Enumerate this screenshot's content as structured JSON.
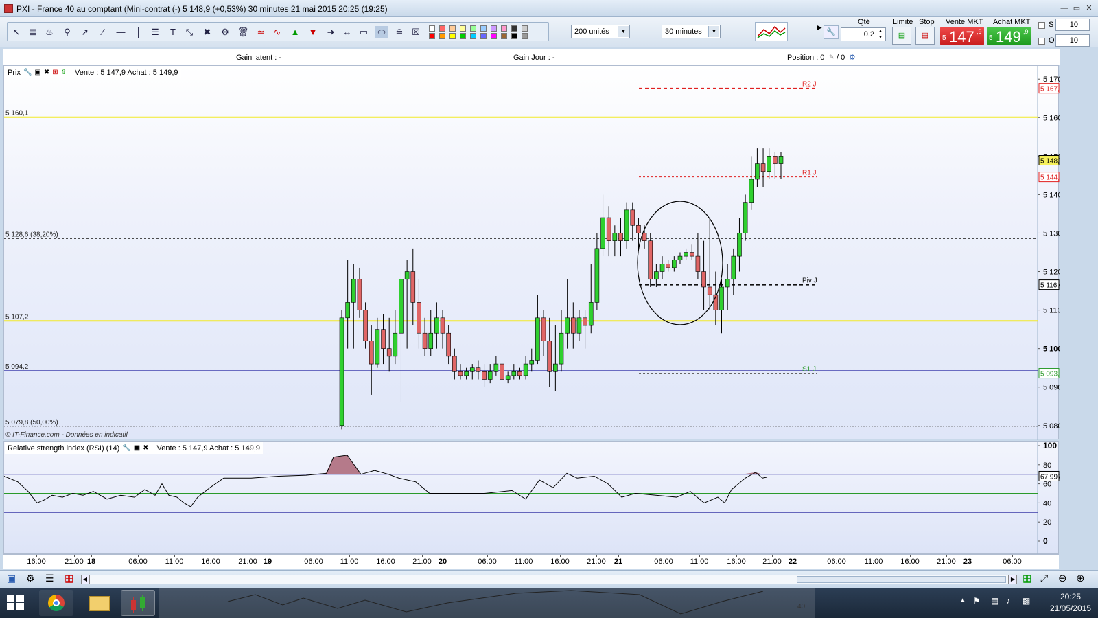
{
  "window": {
    "title": "PXI - France 40 au comptant (Mini-contrat  (-)    5 148,9 (+0,53%)    30 minutes  21 mai 2015 20:25 (19:25)"
  },
  "toolbar": {
    "units_select": "200 unités",
    "interval_select": "30 minutes",
    "qty_label": "Qté",
    "qty_value": "0.2",
    "limit_label": "Limite",
    "stop_label": "Stop",
    "sell_label": "Vente MKT",
    "sell_prefix": "5",
    "sell_main": "147",
    "sell_suffix": ",9",
    "buy_label": "Achat MKT",
    "buy_prefix": "5",
    "buy_main": "149",
    "buy_suffix": ",9",
    "s_label": "S",
    "s_value": "10",
    "o_label": "O",
    "o_value": "10",
    "colors": [
      "#ffffff",
      "#ff6666",
      "#ffcc99",
      "#ffff99",
      "#99ff99",
      "#99ccff",
      "#cc99ff",
      "#ff99cc",
      "#333333",
      "#cccccc",
      "#ff0000",
      "#ff9900",
      "#ffff00",
      "#00cc00",
      "#00ccff",
      "#6666ff",
      "#ff00ff",
      "#996633",
      "#000000",
      "#999999"
    ]
  },
  "infobar": {
    "gain_latent": "Gain latent : -",
    "gain_jour": "Gain Jour : -",
    "position": "Position : 0",
    "position_sep": "/  0"
  },
  "price_panel": {
    "label": "Prix",
    "quote": "Vente : 5 147,9 Achat : 5 149,9",
    "footer": "© IT-Finance.com - Données en indicatif",
    "left_labels": [
      "5 160,1",
      "5 128,6 (38,20%)",
      "5 107,2",
      "5 094,2",
      "5 079,8 (50,00%)"
    ],
    "pivot_labels": [
      "R2 J",
      "R1 J",
      "Piv J",
      "S1 J"
    ],
    "right_badges": [
      "5 167,6",
      "5 148,9",
      "5 144,6",
      "5 116,6",
      "5 093,6"
    ],
    "axis_ticks": [
      "5 170",
      "5 160",
      "5 150",
      "5 140",
      "5 130",
      "5 120",
      "5 110",
      "5 100",
      "5 090",
      "5 080"
    ]
  },
  "rsi_panel": {
    "label": "Relative strength index (RSI) (14)",
    "quote": "Vente : 5 147,9 Achat : 5 149,9",
    "value_badge": "67,997",
    "axis_ticks": [
      "100",
      "80",
      "60",
      "40",
      "20",
      "0"
    ]
  },
  "time_axis": {
    "labels": [
      "16:00",
      "21:00",
      "18",
      "06:00",
      "11:00",
      "16:00",
      "21:00",
      "19",
      "06:00",
      "11:00",
      "16:00",
      "21:00",
      "20",
      "06:00",
      "11:00",
      "16:00",
      "21:00",
      "21",
      "06:00",
      "11:00",
      "16:00",
      "21:00",
      "22",
      "06:00",
      "11:00",
      "16:00",
      "21:00",
      "23",
      "06:00"
    ]
  },
  "taskbar": {
    "time": "20:25",
    "date": "21/05/2015",
    "mini_label": "40"
  },
  "chart_data": {
    "type": "candlestick",
    "ylim": [
      5078,
      5172
    ],
    "levels": {
      "fib_5160_1": 5160.1,
      "fib_38_2": 5128.6,
      "level_5107_2": 5107.2,
      "level_5094_2": 5094.2,
      "fib_50": 5079.8,
      "R2": 5167.6,
      "R1": 5144.6,
      "Piv": 5116.6,
      "S1": 5093.6
    },
    "candles": [
      [
        5080,
        5108,
        5079,
        5110
      ],
      [
        5108,
        5112,
        5100,
        5123
      ],
      [
        5112,
        5118,
        5100,
        5122
      ],
      [
        5118,
        5110,
        5108,
        5121
      ],
      [
        5110,
        5102,
        5100,
        5112
      ],
      [
        5102,
        5096,
        5088,
        5106
      ],
      [
        5096,
        5105,
        5095,
        5108
      ],
      [
        5105,
        5100,
        5096,
        5109
      ],
      [
        5100,
        5098,
        5094,
        5108
      ],
      [
        5098,
        5104,
        5096,
        5110
      ],
      [
        5104,
        5118,
        5086,
        5120
      ],
      [
        5118,
        5120,
        5100,
        5123
      ],
      [
        5120,
        5112,
        5106,
        5126
      ],
      [
        5112,
        5104,
        5100,
        5118
      ],
      [
        5104,
        5100,
        5098,
        5108
      ],
      [
        5100,
        5104,
        5098,
        5110
      ],
      [
        5104,
        5108,
        5100,
        5112
      ],
      [
        5108,
        5104,
        5100,
        5110
      ],
      [
        5104,
        5098,
        5096,
        5106
      ],
      [
        5098,
        5094,
        5092,
        5100
      ],
      [
        5094,
        5093,
        5092,
        5096
      ],
      [
        5093,
        5094,
        5092,
        5095
      ],
      [
        5094,
        5095,
        5092,
        5096
      ],
      [
        5095,
        5094,
        5092,
        5097
      ],
      [
        5094,
        5092,
        5090,
        5096
      ],
      [
        5092,
        5094,
        5091,
        5096
      ],
      [
        5094,
        5096,
        5093,
        5098
      ],
      [
        5096,
        5092,
        5090,
        5098
      ],
      [
        5092,
        5093,
        5091,
        5094
      ],
      [
        5093,
        5094,
        5092,
        5096
      ],
      [
        5094,
        5093,
        5092,
        5095
      ],
      [
        5093,
        5096,
        5092,
        5098
      ],
      [
        5096,
        5097,
        5094,
        5100
      ],
      [
        5097,
        5108,
        5096,
        5114
      ],
      [
        5108,
        5102,
        5098,
        5110
      ],
      [
        5102,
        5094,
        5090,
        5108
      ],
      [
        5094,
        5096,
        5089,
        5106
      ],
      [
        5096,
        5104,
        5094,
        5110
      ],
      [
        5104,
        5108,
        5100,
        5118
      ],
      [
        5108,
        5104,
        5100,
        5112
      ],
      [
        5104,
        5108,
        5102,
        5110
      ],
      [
        5108,
        5106,
        5100,
        5110
      ],
      [
        5106,
        5112,
        5104,
        5122
      ],
      [
        5112,
        5126,
        5110,
        5130
      ],
      [
        5126,
        5134,
        5124,
        5140
      ],
      [
        5134,
        5128,
        5124,
        5137
      ],
      [
        5128,
        5130,
        5124,
        5132
      ],
      [
        5130,
        5128,
        5124,
        5134
      ],
      [
        5128,
        5136,
        5126,
        5138
      ],
      [
        5136,
        5132,
        5128,
        5138
      ],
      [
        5132,
        5130,
        5126,
        5134
      ],
      [
        5130,
        5128,
        5126,
        5132
      ],
      [
        5128,
        5118,
        5116,
        5130
      ],
      [
        5118,
        5120,
        5116,
        5122
      ],
      [
        5120,
        5122,
        5118,
        5124
      ],
      [
        5122,
        5121,
        5120,
        5123
      ],
      [
        5121,
        5123,
        5120,
        5124
      ],
      [
        5123,
        5124,
        5122,
        5125
      ],
      [
        5124,
        5125,
        5123,
        5126
      ],
      [
        5125,
        5124,
        5123,
        5127
      ],
      [
        5124,
        5120,
        5118,
        5130
      ],
      [
        5120,
        5116,
        5110,
        5128
      ],
      [
        5116,
        5114,
        5110,
        5134
      ],
      [
        5114,
        5110,
        5106,
        5120
      ],
      [
        5110,
        5116,
        5104,
        5118
      ],
      [
        5116,
        5118,
        5110,
        5122
      ],
      [
        5118,
        5124,
        5114,
        5126
      ],
      [
        5124,
        5130,
        5120,
        5134
      ],
      [
        5130,
        5138,
        5128,
        5140
      ],
      [
        5138,
        5144,
        5136,
        5150
      ],
      [
        5144,
        5148,
        5142,
        5152
      ],
      [
        5148,
        5146,
        5142,
        5152
      ],
      [
        5146,
        5150,
        5144,
        5152
      ],
      [
        5150,
        5148,
        5144,
        5151
      ],
      [
        5148,
        5150,
        5144,
        5151
      ]
    ]
  }
}
